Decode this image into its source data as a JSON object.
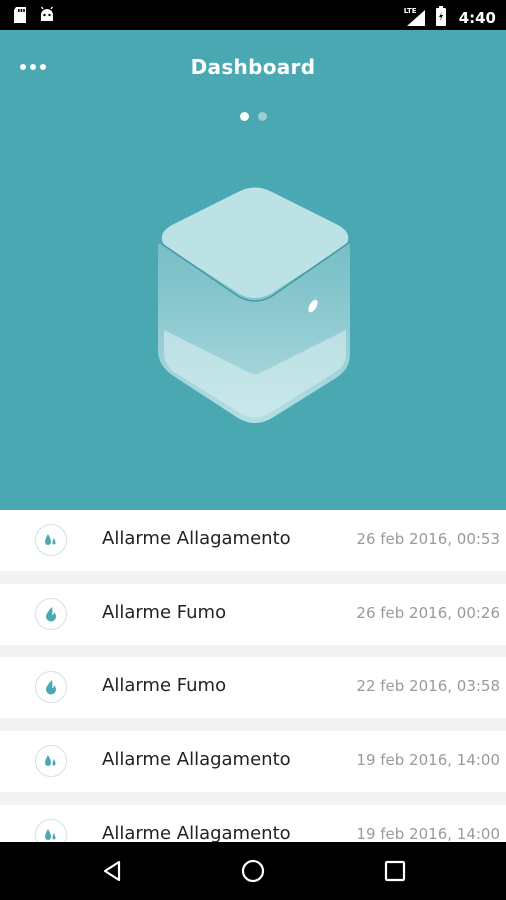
{
  "status_bar": {
    "time": "4:40",
    "network_label": "LTE",
    "left_icons": [
      "sd-card-icon",
      "android-icon"
    ],
    "right_icons": [
      "signal-icon",
      "battery-icon"
    ]
  },
  "header": {
    "title": "Dashboard",
    "menu_icon": "more-horizontal-icon",
    "pager": {
      "total": 2,
      "active_index": 0
    }
  },
  "colors": {
    "accent": "#4aa8b3",
    "event_icon": "#4aa8b3"
  },
  "events": [
    {
      "title": "Allarme Allagamento",
      "date": "26 feb 2016, 00:53",
      "icon": "water-drops-icon"
    },
    {
      "title": "Allarme Fumo",
      "date": "26 feb 2016, 00:26",
      "icon": "flame-icon"
    },
    {
      "title": "Allarme Fumo",
      "date": "22 feb 2016, 03:58",
      "icon": "flame-icon"
    },
    {
      "title": "Allarme Allagamento",
      "date": "19 feb 2016, 14:00",
      "icon": "water-drops-icon"
    },
    {
      "title": "Allarme Allagamento",
      "date": "19 feb 2016, 14:00",
      "icon": "water-drops-icon"
    }
  ],
  "nav_bar": {
    "buttons": [
      "back-icon",
      "home-icon",
      "recents-icon"
    ]
  }
}
